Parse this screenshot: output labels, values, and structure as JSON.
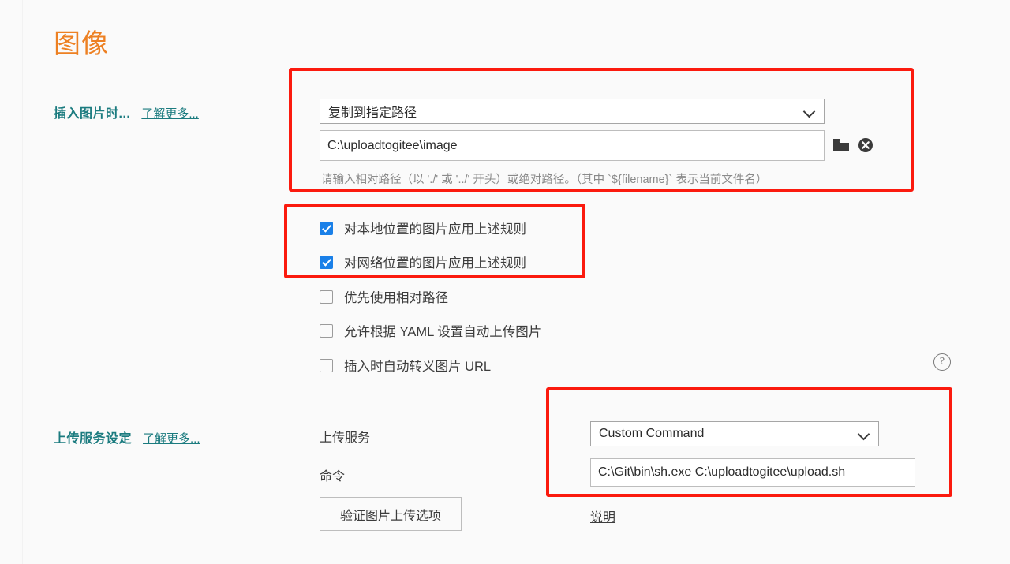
{
  "section": {
    "title": "图像"
  },
  "rows": {
    "insert_image": {
      "label": "插入图片时...",
      "learn_more": "了解更多..."
    },
    "upload_service": {
      "label": "上传服务设定",
      "learn_more": "了解更多..."
    }
  },
  "image_action": {
    "selected": "复制到指定路径",
    "options": [
      "复制到指定路径"
    ],
    "path_value": "C:\\uploadtogitee\\image",
    "path_hint": "请输入相对路径（以 './' 或 '../' 开头）或绝对路径。（其中 `${filename}` 表示当前文件名）",
    "browse_icon": "folder-icon",
    "clear_icon": "clear-circle-icon"
  },
  "checkboxes": [
    {
      "label": "对本地位置的图片应用上述规则",
      "checked": true
    },
    {
      "label": "对网络位置的图片应用上述规则",
      "checked": true
    },
    {
      "label": "优先使用相对路径",
      "checked": false
    },
    {
      "label": "允许根据 YAML 设置自动上传图片",
      "checked": false
    },
    {
      "label": "插入时自动转义图片 URL",
      "checked": false
    }
  ],
  "help": {
    "glyph": "?",
    "icon": "question-circle-icon"
  },
  "upload": {
    "service_label": "上传服务",
    "command_label": "命令",
    "service_selected": "Custom Command",
    "service_options": [
      "Custom Command"
    ],
    "command_value": "C:\\Git\\bin\\sh.exe C:\\uploadtogitee\\upload.sh",
    "verify_button": "验证图片上传选项",
    "doc_link": "说明"
  },
  "colors": {
    "title": "#ED8022",
    "label": "#1B7B7F",
    "checkbox_on": "#1A80E8",
    "annotation": "#FB1A0E",
    "background": "#FAFAFA"
  },
  "annotations": [
    {
      "name": "path-settings-highlight"
    },
    {
      "name": "apply-rules-checkboxes-highlight"
    },
    {
      "name": "custom-command-highlight"
    }
  ]
}
